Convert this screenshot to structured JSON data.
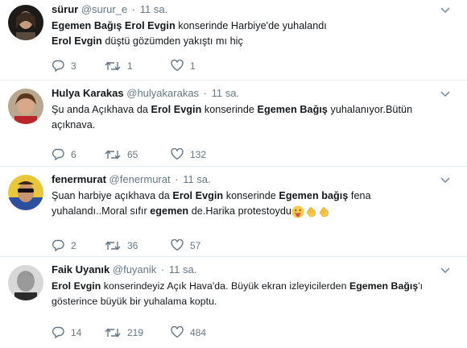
{
  "tweets": [
    {
      "name": "sürur",
      "handle": "@surur_e",
      "time": "11 sa.",
      "lines": [
        [
          {
            "t": "Egemen Bağış Erol Evgin",
            "b": true
          },
          {
            "t": " konserinde Harbiye'de yuhalandı",
            "b": false
          }
        ],
        [
          {
            "t": "Erol Evgin",
            "b": true
          },
          {
            "t": " düştü gözümden yakıştı mı hiç",
            "b": false
          }
        ]
      ],
      "replies": "3",
      "retweets": "1",
      "likes": "1"
    },
    {
      "name": "Hulya Karakas",
      "handle": "@hulyakarakas",
      "time": "11 sa.",
      "lines": [
        [
          {
            "t": "Şu anda Açıkhava da ",
            "b": false
          },
          {
            "t": "Erol Evgin",
            "b": true
          },
          {
            "t": " konserinde ",
            "b": false
          },
          {
            "t": "Egemen Bağış",
            "b": true
          },
          {
            "t": " yuhalanıyor.Bütün",
            "b": false
          }
        ],
        [
          {
            "t": "açıknava.",
            "b": false
          }
        ]
      ],
      "replies": "6",
      "retweets": "65",
      "likes": "132"
    },
    {
      "name": "fenermurat",
      "handle": "@fenermurat",
      "time": "11 sa.",
      "lines": [
        [
          {
            "t": "Şuan harbiye açıkhava da ",
            "b": false
          },
          {
            "t": "Erol Evgin",
            "b": true
          },
          {
            "t": " konserinde ",
            "b": false
          },
          {
            "t": "Egemen bağış",
            "b": true
          },
          {
            "t": " fena",
            "b": false
          }
        ],
        [
          {
            "t": "yuhalandı..Moral sıfır ",
            "b": false
          },
          {
            "t": "egemen",
            "b": true
          },
          {
            "t": " de.Harika protestoydu",
            "b": false
          }
        ]
      ],
      "emojis": [
        "tongue-emoji",
        "clap-emoji",
        "clap-emoji"
      ],
      "replies": "2",
      "retweets": "36",
      "likes": "57"
    },
    {
      "name": "Faik Uyanık",
      "handle": "@fuyanik",
      "time": "11 sa.",
      "lines": [
        [
          {
            "t": "Erol Evgin",
            "b": true
          },
          {
            "t": " konserindeyiz Açık Hava'da. Büyük ekran izleyicilerden ",
            "b": false
          },
          {
            "t": "Egemen Bağış",
            "b": true
          },
          {
            "t": "'ı",
            "b": false
          }
        ],
        [
          {
            "t": "gösterince büyük bir yuhalama koptu.",
            "b": false
          }
        ]
      ],
      "replies": "14",
      "retweets": "219",
      "likes": "484"
    }
  ],
  "icons": {
    "reply": "reply-icon",
    "retweet": "retweet-icon",
    "like": "heart-icon",
    "menu": "chevron-down-icon"
  },
  "colors": {
    "secondary": "#657786",
    "divider": "#e6ecf0",
    "text": "#14171a"
  }
}
